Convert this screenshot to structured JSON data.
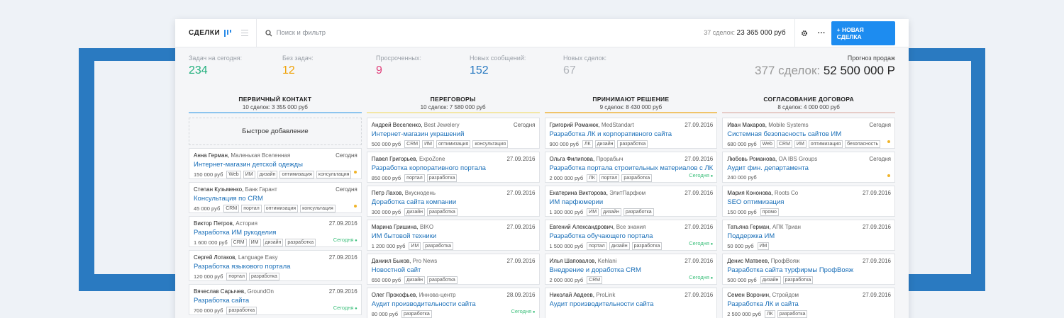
{
  "topbar": {
    "title": "СДЕЛКИ",
    "search_placeholder": "Поиск и фильтр",
    "stats_label": "37 сделок:",
    "stats_value": "23 365 000 руб",
    "new_deal_label": "+ НОВАЯ СДЕЛКА"
  },
  "summary": [
    {
      "label": "Задач на сегодня:",
      "value": "234",
      "color": "#22b07d"
    },
    {
      "label": "Без задач:",
      "value": "12",
      "color": "#f0a30a"
    },
    {
      "label": "Просроченных:",
      "value": "9",
      "color": "#e0407b"
    },
    {
      "label": "Новых сообщений:",
      "value": "152",
      "color": "#2a7ac1"
    },
    {
      "label": "Новых сделок:",
      "value": "67",
      "color": "#b0b4ba"
    }
  ],
  "forecast": {
    "label": "Прогноз продаж",
    "count": "377 сделок:",
    "amount": "52 500 000 Р"
  },
  "quick_add": "Быстрое добавление",
  "columns": [
    {
      "title": "ПЕРВИЧНЫЙ КОНТАКТ",
      "sub": "10 сделок: 3 355 000 руб",
      "color": "#8cc4ee",
      "cards": [
        {
          "name": "Анна Герман,",
          "company": "Маленькая Вселенная",
          "date": "Сегодня",
          "title": "Интернет-магазин детской одежды",
          "price": "150 000 руб",
          "tags": [
            "Web",
            "ИМ",
            "дизайн",
            "оптимизация",
            "консультация"
          ],
          "marker": "dot"
        },
        {
          "name": "Степан Кузьменко,",
          "company": "Банк Гарант",
          "date": "Сегодня",
          "title": "Консультация по CRM",
          "price": "45 000 руб",
          "tags": [
            "CRM",
            "портал",
            "оптимизация",
            "консультация"
          ],
          "marker": "dot"
        },
        {
          "name": "Виктор Петров,",
          "company": "Астория",
          "date": "27.09.2016",
          "title": "Разработка ИМ рукоделия",
          "price": "1 600 000 руб",
          "tags": [
            "CRM",
            "ИМ",
            "дизайн",
            "разработка"
          ],
          "marker": "status",
          "status": "Сегодня"
        },
        {
          "name": "Сергей Лотаков,",
          "company": "Language Easy",
          "date": "27.09.2016",
          "title": "Разработка языкового портала",
          "price": "120 000 руб",
          "tags": [
            "портал",
            "разработка"
          ],
          "marker": ""
        },
        {
          "name": "Вячеслав Сарычев,",
          "company": "GroundOn",
          "date": "27.09.2016",
          "title": "Разработка сайта",
          "price": "700 000 руб",
          "tags": [
            "разработка"
          ],
          "marker": "status",
          "status": "Сегодня"
        }
      ]
    },
    {
      "title": "ПЕРЕГОВОРЫ",
      "sub": "10 сделок: 7 580 000 руб",
      "color": "#f3e7a6",
      "cards": [
        {
          "name": "Андрей Веселенко,",
          "company": "Best Jewelery",
          "date": "Сегодня",
          "title": "Интернет-магазин украшений",
          "price": "500 000 руб",
          "tags": [
            "CRM",
            "ИМ",
            "оптимизация",
            "консультация"
          ],
          "marker": ""
        },
        {
          "name": "Павел Григорьев,",
          "company": "ExpoZone",
          "date": "27.09.2016",
          "title": "Разработка корпоративного портала",
          "price": "850 000 руб",
          "tags": [
            "портал",
            "разработка"
          ],
          "marker": ""
        },
        {
          "name": "Петр Лахов,",
          "company": "Вкуснодень",
          "date": "27.09.2016",
          "title": "Доработка сайта компании",
          "price": "300 000 руб",
          "tags": [
            "дизайн",
            "разработка"
          ],
          "marker": ""
        },
        {
          "name": "Марина Гришина,",
          "company": "BIKO",
          "date": "27.09.2016",
          "title": "ИМ бытовой техники",
          "price": "1 200 000 руб",
          "tags": [
            "ИМ",
            "разработка"
          ],
          "marker": ""
        },
        {
          "name": "Даниил Быков,",
          "company": "Pro News",
          "date": "27.09.2016",
          "title": "Новостной сайт",
          "price": "650 000 руб",
          "tags": [
            "дизайн",
            "разработка"
          ],
          "marker": ""
        },
        {
          "name": "Олег Прокофьев,",
          "company": "Иннова-центр",
          "date": "28.09.2016",
          "title": "Аудит производительности сайта",
          "price": "80 000 руб",
          "tags": [
            "разработка"
          ],
          "marker": "status",
          "status": "Сегодня"
        }
      ]
    },
    {
      "title": "ПРИНИМАЮТ РЕШЕНИЕ",
      "sub": "9 сделок: 8 430 000 руб",
      "color": "#f0c46a",
      "cards": [
        {
          "name": "Григорий Романюк,",
          "company": "MedStandart",
          "date": "27.09.2016",
          "title": "Разработка ЛК и корпоративного сайта",
          "price": "900 000 руб",
          "tags": [
            "ЛК",
            "дизайн",
            "разработка"
          ],
          "marker": ""
        },
        {
          "name": "Ольга Филипова,",
          "company": "Прорабыч",
          "date": "27.09.2016",
          "title": "Разработка портала строительных материалов с ЛК",
          "price": "2 000 000 руб",
          "tags": [
            "ЛК",
            "портал",
            "разработка"
          ],
          "marker": "status",
          "status": "Сегодня"
        },
        {
          "name": "Екатерина Викторова,",
          "company": "ЭлитПарфюм",
          "date": "27.09.2016",
          "title": "ИМ парфюмерии",
          "price": "1 300 000 руб",
          "tags": [
            "ИМ",
            "дизайн",
            "разработка"
          ],
          "marker": ""
        },
        {
          "name": "Евгений Александрович,",
          "company": "Все знания",
          "date": "27.09.2016",
          "title": "Разработка обучающего портала",
          "price": "1 500 000 руб",
          "tags": [
            "портал",
            "дизайн",
            "разработка"
          ],
          "marker": "status",
          "status": "Сегодня"
        },
        {
          "name": "Илья Шаповалов,",
          "company": "Kehlani",
          "date": "27.09.2016",
          "title": "Внедрение и доработка CRM",
          "price": "2 000 000 руб",
          "tags": [
            "CRM"
          ],
          "marker": "status",
          "status": "Сегодня"
        },
        {
          "name": "Николай Авдеев,",
          "company": "ProLink",
          "date": "27.09.2016",
          "title": "Аудит производительности сайта",
          "price": "",
          "tags": [],
          "marker": ""
        }
      ]
    },
    {
      "title": "СОГЛАСОВАНИЕ ДОГОВОРА",
      "sub": "8 сделок: 4 000 000 руб",
      "color": "#e6ccc8",
      "cards": [
        {
          "name": "Иван Макаров,",
          "company": "Mobile Systems",
          "date": "Сегодня",
          "title": "Системная безопасность сайтов ИМ",
          "price": "680 000 руб",
          "tags": [
            "Web",
            "CRM",
            "ИМ",
            "оптимизация",
            "безопасность"
          ],
          "marker": "dot"
        },
        {
          "name": "Любовь Романова,",
          "company": "OA IBS Groups",
          "date": "Сегодня",
          "title": "Аудит фин. департамента",
          "price": "240 000 руб",
          "tags": [],
          "marker": "dot"
        },
        {
          "name": "Мария Кононова,",
          "company": "Roots Co",
          "date": "27.09.2016",
          "title": "SEO оптимизация",
          "price": "150 000 руб",
          "tags": [
            "промо"
          ],
          "marker": ""
        },
        {
          "name": "Татьяна Герман,",
          "company": "АПК Триан",
          "date": "27.09.2016",
          "title": "Поддержка ИМ",
          "price": "50 000 руб",
          "tags": [
            "ИМ"
          ],
          "marker": ""
        },
        {
          "name": "Денис Матвеев,",
          "company": "ПрофВояж",
          "date": "27.09.2016",
          "title": "Разработка сайта турфирмы ПрофВояж",
          "price": "500 000 руб",
          "tags": [
            "дизайн",
            "разработка"
          ],
          "marker": ""
        },
        {
          "name": "Семен Воронин,",
          "company": "Стройдом",
          "date": "27.09.2016",
          "title": "Разработка ЛК и сайта",
          "price": "2 500 000 руб",
          "tags": [
            "ЛК",
            "разработка"
          ],
          "marker": ""
        }
      ]
    }
  ]
}
